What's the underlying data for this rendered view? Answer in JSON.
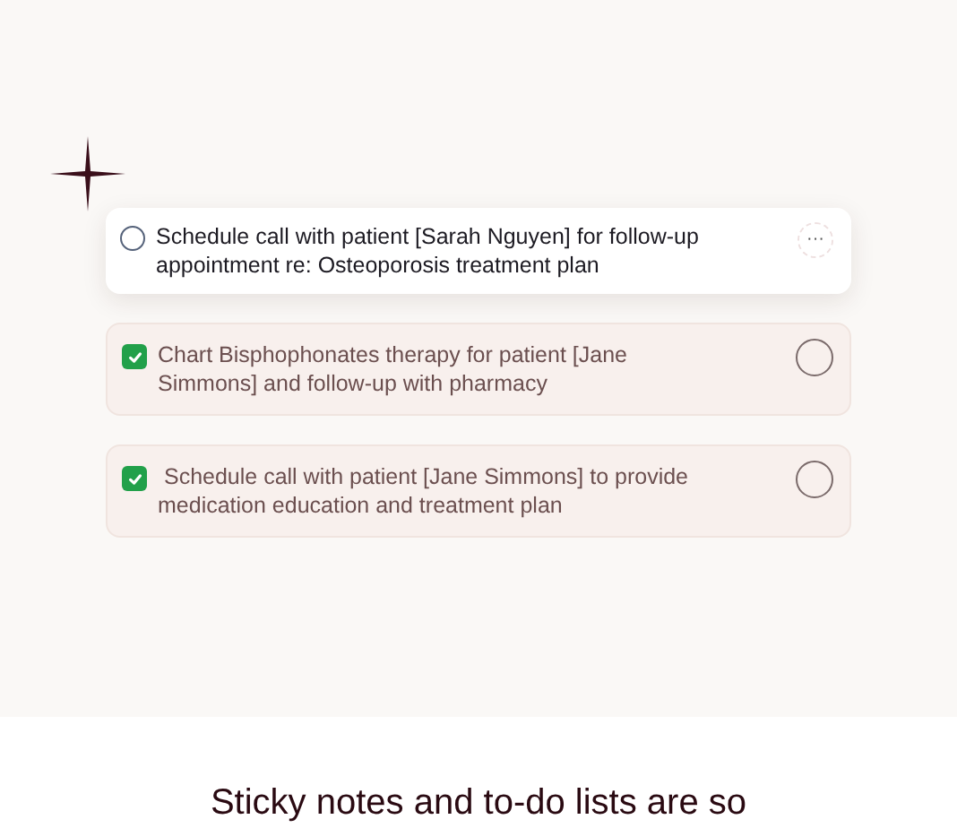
{
  "tasks": [
    {
      "text": "Schedule call with patient [Sarah Nguyen] for follow-up appointment re: Osteoporosis treatment plan",
      "checked": false,
      "menu": "···"
    },
    {
      "text": "Chart Bisphophonates therapy for patient [Jane Simmons] and follow-up with pharmacy",
      "checked": true
    },
    {
      "text": " Schedule call with patient [Jane Simmons] to provide medication education and treatment plan",
      "checked": true
    }
  ],
  "heading": "Sticky notes and to-do lists are so"
}
